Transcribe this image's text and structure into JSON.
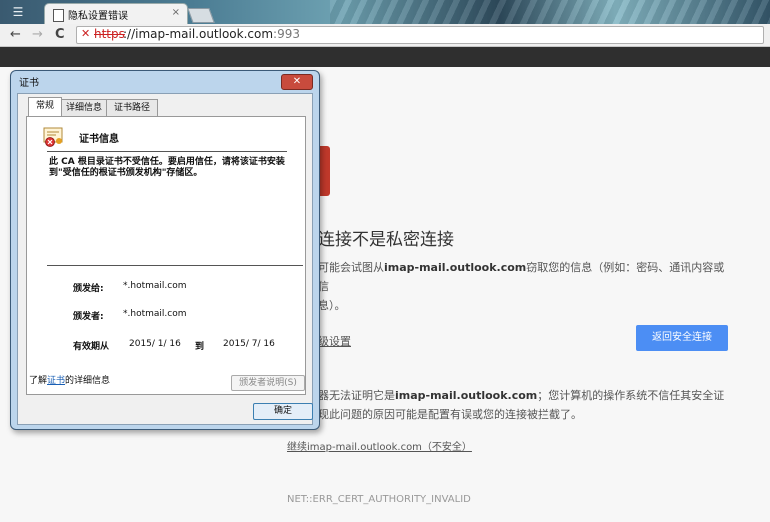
{
  "browser": {
    "tab_title": "隐私设置错误",
    "tab_close": "×",
    "back": "←",
    "forward": "→",
    "reload": "C",
    "url_scheme": "https",
    "url_host": "://imap-mail.outlook.com",
    "url_port": ":993"
  },
  "error_page": {
    "heading": "连接不是私密连接",
    "desc_prefix": "可能会试图从",
    "desc_host": "imap-mail.outlook.com",
    "desc_suffix": "窃取您的信息（例如：密码、通讯内容或信",
    "desc_line2": "息）。",
    "advanced_link": "级设置",
    "back_button": "返回安全连接",
    "adv_prefix": "器无法证明它是",
    "adv_host": "imap-mail.outlook.com",
    "adv_suffix": "；您计算机的操作系统不信任其安全证",
    "adv_line2": "现此问题的原因可能是配置有误或您的连接被拦截了。",
    "proceed_link": "继续imap-mail.outlook.com（不安全）",
    "error_code": "NET::ERR_CERT_AUTHORITY_INVALID"
  },
  "cert_dialog": {
    "title": "证书",
    "close": "✕",
    "tabs": [
      "常规",
      "详细信息",
      "证书路径"
    ],
    "info_title": "证书信息",
    "warning": "此 CA 根目录证书不受信任。要启用信任，请将该证书安装到\"受信任的根证书颁发机构\"存储区。",
    "issued_to_label": "颁发给:",
    "issued_to_value": "*.hotmail.com",
    "issued_by_label": "颁发者:",
    "issued_by_value": "*.hotmail.com",
    "valid_label": "有效期从",
    "valid_from": "2015/ 1/ 16",
    "valid_to_word": "到",
    "valid_to": "2015/ 7/ 16",
    "issuer_statement_button": "颁发者说明(S)",
    "learn_prefix": "了解",
    "learn_link": "证书",
    "learn_suffix": "的详细信息",
    "ok_button": "确定"
  }
}
